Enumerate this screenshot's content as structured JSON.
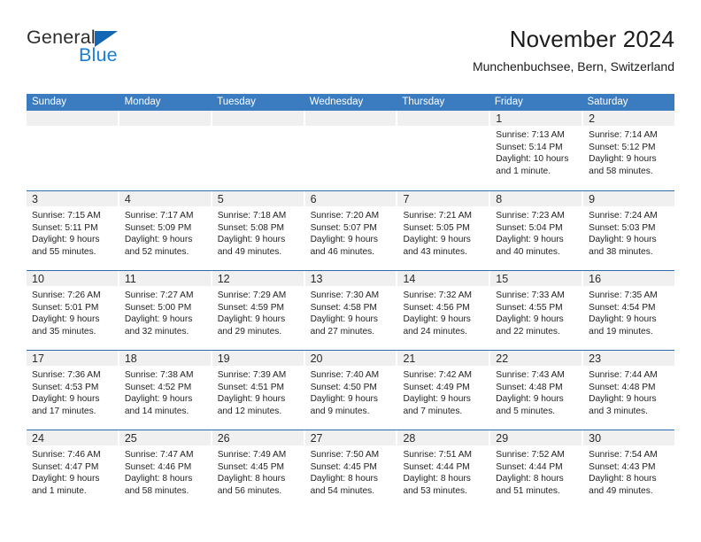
{
  "brand": {
    "name_part1": "General",
    "name_part2": "Blue",
    "triangle_icon": "triangle-icon",
    "accent_blue": "#1a7fd4",
    "triangle_blue": "#1266b3"
  },
  "header": {
    "title": "November 2024",
    "subtitle": "Munchenbuchsee, Bern, Switzerland"
  },
  "theme": {
    "header_row_bg": "#3b7cc0",
    "week_border": "#2e6da9",
    "daynum_band_bg": "#f0f0f0",
    "text": "#1f1f1f"
  },
  "weekdays": [
    "Sunday",
    "Monday",
    "Tuesday",
    "Wednesday",
    "Thursday",
    "Friday",
    "Saturday"
  ],
  "weeks": [
    [
      {
        "day": "",
        "lines": []
      },
      {
        "day": "",
        "lines": []
      },
      {
        "day": "",
        "lines": []
      },
      {
        "day": "",
        "lines": []
      },
      {
        "day": "",
        "lines": []
      },
      {
        "day": "1",
        "lines": [
          "Sunrise: 7:13 AM",
          "Sunset: 5:14 PM",
          "Daylight: 10 hours",
          "and 1 minute."
        ]
      },
      {
        "day": "2",
        "lines": [
          "Sunrise: 7:14 AM",
          "Sunset: 5:12 PM",
          "Daylight: 9 hours",
          "and 58 minutes."
        ]
      }
    ],
    [
      {
        "day": "3",
        "lines": [
          "Sunrise: 7:15 AM",
          "Sunset: 5:11 PM",
          "Daylight: 9 hours",
          "and 55 minutes."
        ]
      },
      {
        "day": "4",
        "lines": [
          "Sunrise: 7:17 AM",
          "Sunset: 5:09 PM",
          "Daylight: 9 hours",
          "and 52 minutes."
        ]
      },
      {
        "day": "5",
        "lines": [
          "Sunrise: 7:18 AM",
          "Sunset: 5:08 PM",
          "Daylight: 9 hours",
          "and 49 minutes."
        ]
      },
      {
        "day": "6",
        "lines": [
          "Sunrise: 7:20 AM",
          "Sunset: 5:07 PM",
          "Daylight: 9 hours",
          "and 46 minutes."
        ]
      },
      {
        "day": "7",
        "lines": [
          "Sunrise: 7:21 AM",
          "Sunset: 5:05 PM",
          "Daylight: 9 hours",
          "and 43 minutes."
        ]
      },
      {
        "day": "8",
        "lines": [
          "Sunrise: 7:23 AM",
          "Sunset: 5:04 PM",
          "Daylight: 9 hours",
          "and 40 minutes."
        ]
      },
      {
        "day": "9",
        "lines": [
          "Sunrise: 7:24 AM",
          "Sunset: 5:03 PM",
          "Daylight: 9 hours",
          "and 38 minutes."
        ]
      }
    ],
    [
      {
        "day": "10",
        "lines": [
          "Sunrise: 7:26 AM",
          "Sunset: 5:01 PM",
          "Daylight: 9 hours",
          "and 35 minutes."
        ]
      },
      {
        "day": "11",
        "lines": [
          "Sunrise: 7:27 AM",
          "Sunset: 5:00 PM",
          "Daylight: 9 hours",
          "and 32 minutes."
        ]
      },
      {
        "day": "12",
        "lines": [
          "Sunrise: 7:29 AM",
          "Sunset: 4:59 PM",
          "Daylight: 9 hours",
          "and 29 minutes."
        ]
      },
      {
        "day": "13",
        "lines": [
          "Sunrise: 7:30 AM",
          "Sunset: 4:58 PM",
          "Daylight: 9 hours",
          "and 27 minutes."
        ]
      },
      {
        "day": "14",
        "lines": [
          "Sunrise: 7:32 AM",
          "Sunset: 4:56 PM",
          "Daylight: 9 hours",
          "and 24 minutes."
        ]
      },
      {
        "day": "15",
        "lines": [
          "Sunrise: 7:33 AM",
          "Sunset: 4:55 PM",
          "Daylight: 9 hours",
          "and 22 minutes."
        ]
      },
      {
        "day": "16",
        "lines": [
          "Sunrise: 7:35 AM",
          "Sunset: 4:54 PM",
          "Daylight: 9 hours",
          "and 19 minutes."
        ]
      }
    ],
    [
      {
        "day": "17",
        "lines": [
          "Sunrise: 7:36 AM",
          "Sunset: 4:53 PM",
          "Daylight: 9 hours",
          "and 17 minutes."
        ]
      },
      {
        "day": "18",
        "lines": [
          "Sunrise: 7:38 AM",
          "Sunset: 4:52 PM",
          "Daylight: 9 hours",
          "and 14 minutes."
        ]
      },
      {
        "day": "19",
        "lines": [
          "Sunrise: 7:39 AM",
          "Sunset: 4:51 PM",
          "Daylight: 9 hours",
          "and 12 minutes."
        ]
      },
      {
        "day": "20",
        "lines": [
          "Sunrise: 7:40 AM",
          "Sunset: 4:50 PM",
          "Daylight: 9 hours",
          "and 9 minutes."
        ]
      },
      {
        "day": "21",
        "lines": [
          "Sunrise: 7:42 AM",
          "Sunset: 4:49 PM",
          "Daylight: 9 hours",
          "and 7 minutes."
        ]
      },
      {
        "day": "22",
        "lines": [
          "Sunrise: 7:43 AM",
          "Sunset: 4:48 PM",
          "Daylight: 9 hours",
          "and 5 minutes."
        ]
      },
      {
        "day": "23",
        "lines": [
          "Sunrise: 7:44 AM",
          "Sunset: 4:48 PM",
          "Daylight: 9 hours",
          "and 3 minutes."
        ]
      }
    ],
    [
      {
        "day": "24",
        "lines": [
          "Sunrise: 7:46 AM",
          "Sunset: 4:47 PM",
          "Daylight: 9 hours",
          "and 1 minute."
        ]
      },
      {
        "day": "25",
        "lines": [
          "Sunrise: 7:47 AM",
          "Sunset: 4:46 PM",
          "Daylight: 8 hours",
          "and 58 minutes."
        ]
      },
      {
        "day": "26",
        "lines": [
          "Sunrise: 7:49 AM",
          "Sunset: 4:45 PM",
          "Daylight: 8 hours",
          "and 56 minutes."
        ]
      },
      {
        "day": "27",
        "lines": [
          "Sunrise: 7:50 AM",
          "Sunset: 4:45 PM",
          "Daylight: 8 hours",
          "and 54 minutes."
        ]
      },
      {
        "day": "28",
        "lines": [
          "Sunrise: 7:51 AM",
          "Sunset: 4:44 PM",
          "Daylight: 8 hours",
          "and 53 minutes."
        ]
      },
      {
        "day": "29",
        "lines": [
          "Sunrise: 7:52 AM",
          "Sunset: 4:44 PM",
          "Daylight: 8 hours",
          "and 51 minutes."
        ]
      },
      {
        "day": "30",
        "lines": [
          "Sunrise: 7:54 AM",
          "Sunset: 4:43 PM",
          "Daylight: 8 hours",
          "and 49 minutes."
        ]
      }
    ]
  ]
}
